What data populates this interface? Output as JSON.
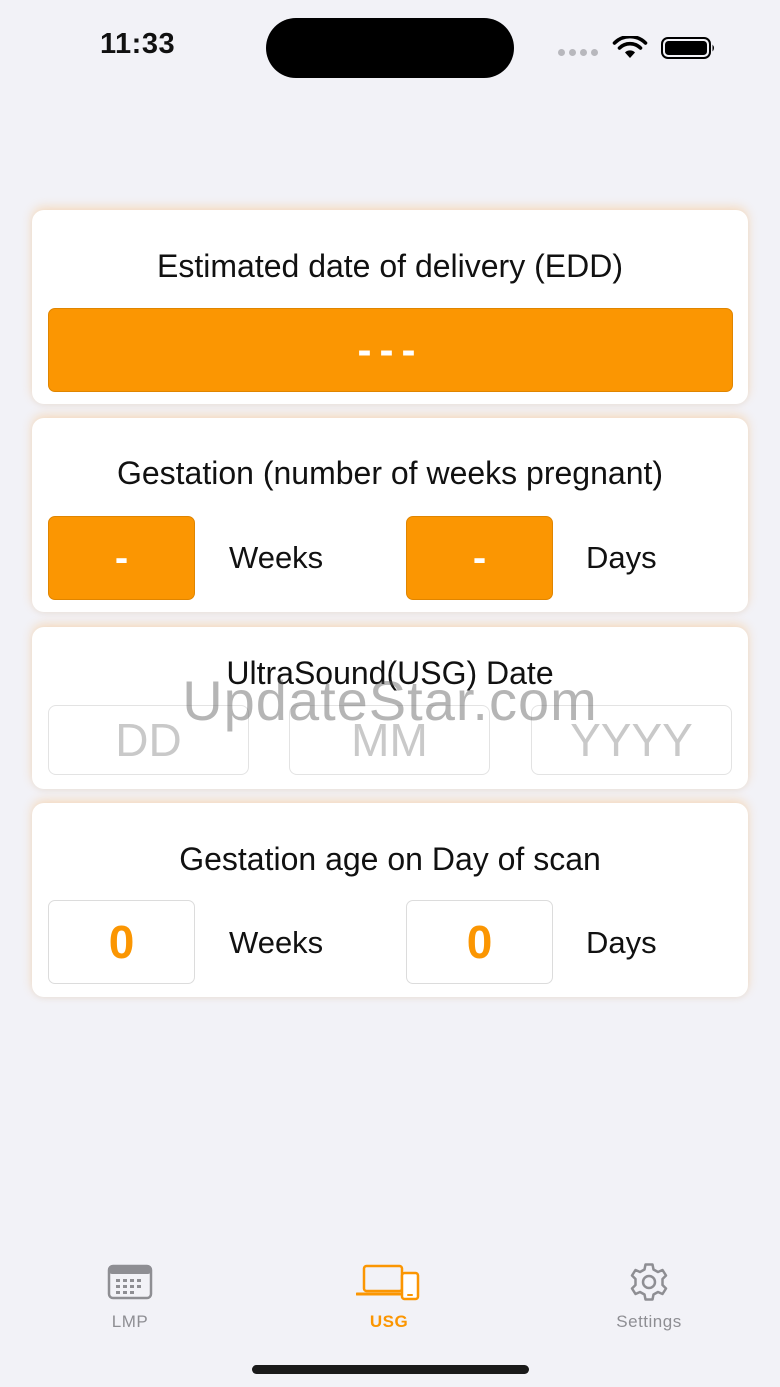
{
  "status_bar": {
    "time": "11:33"
  },
  "edd_card": {
    "title": "Estimated date of delivery (EDD)",
    "value": "---"
  },
  "gestation_card": {
    "title": "Gestation (number of weeks pregnant)",
    "weeks_value": "-",
    "weeks_label": "Weeks",
    "days_value": "-",
    "days_label": "Days"
  },
  "usg_date_card": {
    "title": "UltraSound(USG) Date",
    "dd_placeholder": "DD",
    "mm_placeholder": "MM",
    "yyyy_placeholder": "YYYY"
  },
  "scan_age_card": {
    "title": "Gestation age on Day of scan",
    "weeks_value": "0",
    "weeks_label": "Weeks",
    "days_value": "0",
    "days_label": "Days"
  },
  "watermark": "UpdateStar.com",
  "tab_bar": {
    "items": [
      {
        "label": "LMP",
        "icon": "calendar-icon"
      },
      {
        "label": "USG",
        "icon": "devices-icon",
        "active": true
      },
      {
        "label": "Settings",
        "icon": "gear-icon"
      }
    ]
  },
  "colors": {
    "accent": "#fb9602",
    "background": "#f2f2f7",
    "inactive": "#8e8e93"
  }
}
